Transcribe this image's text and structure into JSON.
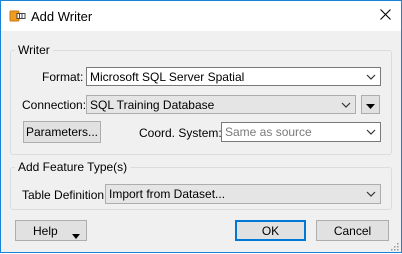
{
  "window": {
    "title": "Add Writer"
  },
  "writer_group": {
    "legend": "Writer",
    "format_label": "Format:",
    "format_value": "Microsoft SQL Server Spatial",
    "connection_label": "Connection:",
    "connection_value": "SQL Training Database",
    "parameters_button": "Parameters...",
    "coord_label": "Coord. System:",
    "coord_value": "Same as source"
  },
  "feature_type_group": {
    "legend": "Add Feature Type(s)",
    "table_definition_label": "Table Definition:",
    "table_definition_value": "Import from Dataset..."
  },
  "footer": {
    "help_button": "Help",
    "ok_button": "OK",
    "cancel_button": "Cancel"
  },
  "icons": {
    "app": "fme-writer-icon",
    "close": "close-icon",
    "dropdown": "chevron-down-icon",
    "menu": "triangle-down-icon",
    "resize": "resize-grip-icon"
  },
  "colors": {
    "accent": "#0078d7",
    "window_border": "#1883d7",
    "dialog_bg": "#f0f0f0",
    "app_icon": "#f29c1e"
  }
}
